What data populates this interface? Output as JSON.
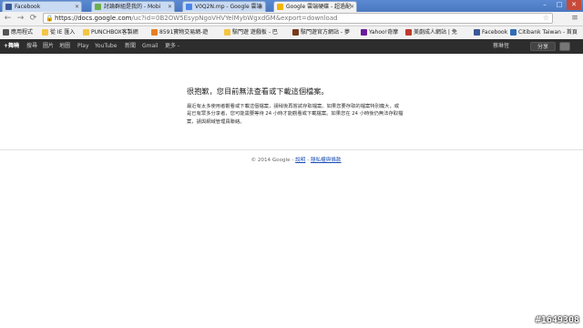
{
  "tabs": [
    {
      "label": "Facebook",
      "icon": "facebook-icon",
      "color": "#3b5998",
      "active": false
    },
    {
      "label": "討論群組是我的 - Mobi",
      "icon": "page-icon",
      "color": "#6ab04c",
      "active": false
    },
    {
      "label": "V0Q2N.mp - Google 雲端",
      "icon": "drive-icon",
      "color": "#4a86e8",
      "active": false
    },
    {
      "label": "Google 雲端硬碟 - 超過配",
      "icon": "drive-icon",
      "color": "#f4b400",
      "active": true
    }
  ],
  "window_controls": {
    "minimize": "–",
    "maximize": "□",
    "close": "✕"
  },
  "toolbar": {
    "url_host": "https://docs.google.com",
    "url_rest": "/uc?id=0B2OW5EsypNgoVHVYelMybWgxdGM&export=download"
  },
  "bookmarks": [
    {
      "label": "應用程式",
      "color": "#555555"
    },
    {
      "label": "從 IE 匯入",
      "color": "#f4c542"
    },
    {
      "label": "PUNCHBOX客製網",
      "color": "#f4c542"
    },
    {
      "label": "8591寶物交易網-遊",
      "color": "#e67e22"
    },
    {
      "label": "駭門遊 遊戲板 - 巴",
      "color": "#f4c542"
    },
    {
      "label": "駭門遊官方網站 - 夢",
      "color": "#7a3a1a"
    },
    {
      "label": "Yahoo!奇摩",
      "color": "#6a1b9a"
    },
    {
      "label": "美劇成人網站 | 免",
      "color": "#c0392b"
    },
    {
      "label": "Facebook",
      "color": "#3b5998"
    },
    {
      "label": "Citibank Taiwan - 首頁",
      "color": "#2f6db5"
    }
  ],
  "google_bar": {
    "items": [
      "+舞曉",
      "搜尋",
      "圖片",
      "地圖",
      "Play",
      "YouTube",
      "新聞",
      "Gmail",
      "更多 -"
    ],
    "user": "蔡琳恆",
    "share_button": "分享"
  },
  "content": {
    "title": "很抱歉，您目前無法查看或下載這個檔案。",
    "body": "最近有太多使用者觀看或下載這個檔案，請稍後再嘗試存取檔案。如果您要存取的檔案特別龐大，或是已有眾多分享者，您可能需要等待 24 小時才能觀看或下載檔案。如果您在 24 小時後仍無法存取檔案，請與網域管理員聯絡。"
  },
  "footer": {
    "copyright": "© 2014 Google -",
    "link1": "說明",
    "separator": "-",
    "link2": "隱私權與條款"
  },
  "watermark": "#1649308"
}
